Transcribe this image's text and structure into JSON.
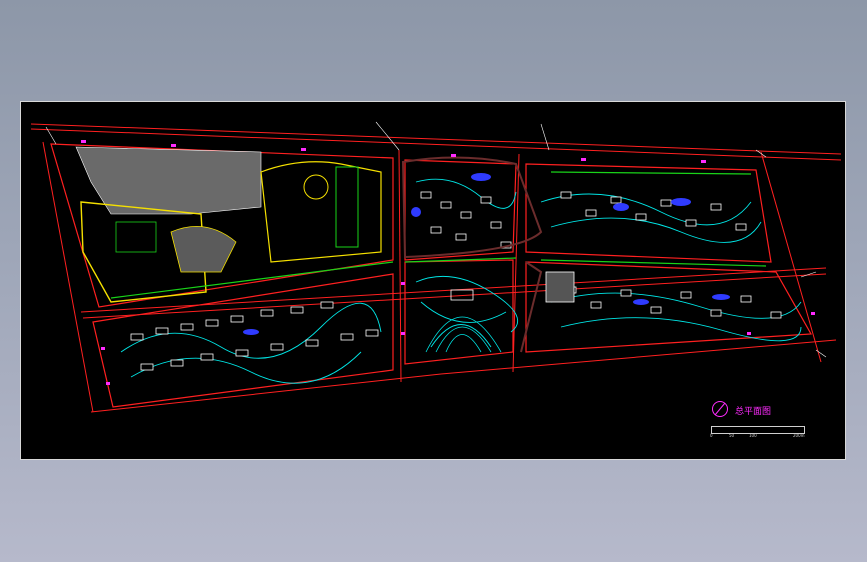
{
  "drawing": {
    "title": "总平面图",
    "scale_ticks": [
      "0",
      "50",
      "100",
      "200m"
    ]
  },
  "colors": {
    "background": "#000000",
    "road": "#ff2020",
    "building": "#ffffff",
    "landscape": "#00e5e5",
    "dimension": "#ff2bff",
    "green": "#19d419",
    "yellow": "#f5e000",
    "blue": "#2f3bff",
    "brown": "#6b2c2c"
  },
  "icons": [
    "north-arrow-icon"
  ]
}
